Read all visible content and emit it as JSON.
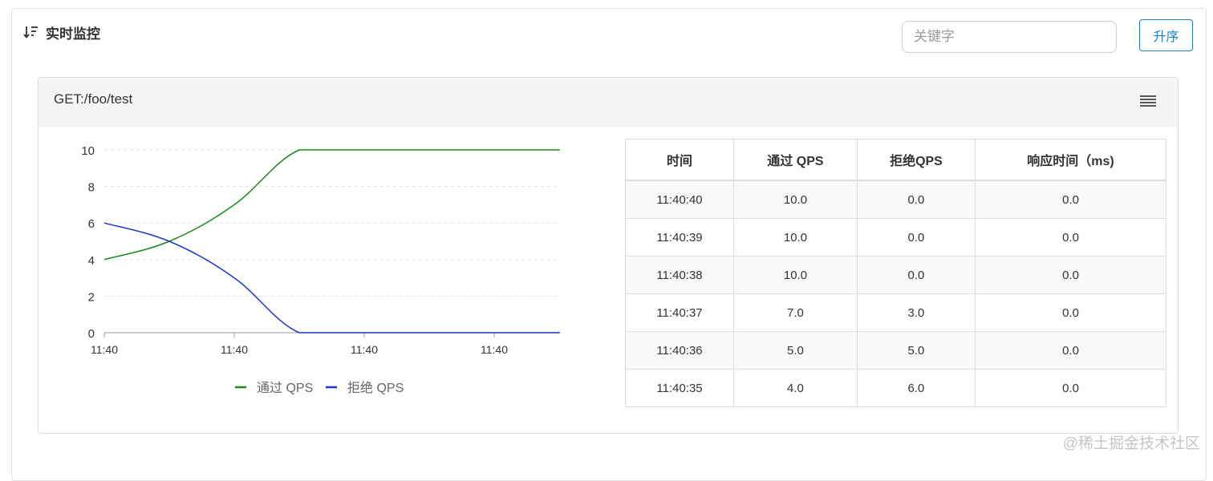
{
  "header": {
    "title": "实时监控",
    "sort_icon": "sort-descending-icon",
    "search_placeholder": "关键字",
    "sort_button": "升序"
  },
  "panel": {
    "title": "GET:/foo/test",
    "menu_icon": "hamburger-menu-icon"
  },
  "colors": {
    "pass": "#1a8a1a",
    "reject": "#2233cc",
    "accent": "#1e7fc7"
  },
  "chart_data": {
    "type": "line",
    "title": "",
    "xlabel": "",
    "ylabel": "",
    "x": [
      "11:40:35",
      "11:40:36",
      "11:40:37",
      "11:40:38",
      "11:40:39",
      "11:40:40"
    ],
    "x_ticks": [
      "11:40",
      "11:40",
      "11:40",
      "11:40"
    ],
    "ylim": [
      0,
      10
    ],
    "y_ticks": [
      0,
      2,
      4,
      6,
      8,
      10
    ],
    "grid": "horizontal-dashed",
    "legend": "bottom",
    "series": [
      {
        "name": "通过 QPS",
        "values": [
          4,
          5,
          7,
          10,
          10,
          10
        ],
        "color": "#1a8a1a"
      },
      {
        "name": "拒绝 QPS",
        "values": [
          6,
          5,
          3,
          0,
          0,
          0
        ],
        "color": "#2233cc"
      }
    ]
  },
  "table": {
    "columns": [
      "时间",
      "通过 QPS",
      "拒绝QPS",
      "响应时间（ms)"
    ],
    "rows": [
      [
        "11:40:40",
        "10.0",
        "0.0",
        "0.0"
      ],
      [
        "11:40:39",
        "10.0",
        "0.0",
        "0.0"
      ],
      [
        "11:40:38",
        "10.0",
        "0.0",
        "0.0"
      ],
      [
        "11:40:37",
        "7.0",
        "3.0",
        "0.0"
      ],
      [
        "11:40:36",
        "5.0",
        "5.0",
        "0.0"
      ],
      [
        "11:40:35",
        "4.0",
        "6.0",
        "0.0"
      ]
    ]
  },
  "watermark": "@稀土掘金技术社区"
}
